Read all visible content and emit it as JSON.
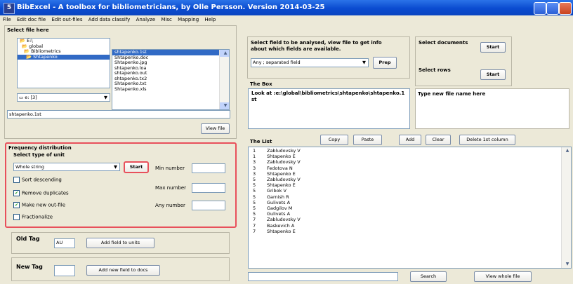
{
  "window": {
    "title": "BibExcel - A toolbox for bibliometricians, by Olle Persson. Version 2014-03-25",
    "icon": "5"
  },
  "menu": [
    "File",
    "Edit doc file",
    "Edit out-files",
    "Add data classify",
    "Analyze",
    "Misc",
    "Mapping",
    "Help"
  ],
  "select_file": {
    "heading": "Select file here",
    "folders": [
      "E:\\",
      "global",
      "Bibliometrics",
      "Shtapenko"
    ],
    "files": [
      "shtapenko.1st",
      "Shtapenko.doc",
      "Shtapenko.jpg",
      "shtapenko.loa",
      "shtapenko.out",
      "shtapenko.tx2",
      "Shtapenko.txt",
      "Shtapenko.xls"
    ],
    "drive": "e: [3]",
    "current_file": "shtapenko.1st",
    "view_file": "View file"
  },
  "frequency": {
    "heading": "Frequency distribution",
    "unit_label": "Select type of unit",
    "unit_value": "Whole string",
    "start": "Start",
    "sort_descending": "Sort descending",
    "remove_duplicates": "Remove duplicates",
    "make_new_outfile": "Make new out-file",
    "fractionalize": "Fractionalize",
    "min_number": "Min number",
    "max_number": "Max number",
    "any_number": "Any number",
    "checks": {
      "sort_descending": false,
      "remove_duplicates": true,
      "make_new_outfile": true,
      "fractionalize": false
    }
  },
  "old_tag": {
    "label": "Old Tag",
    "value": "AU",
    "button": "Add field to units"
  },
  "new_tag": {
    "label": "New Tag",
    "value": "",
    "button": "Add new field to docs"
  },
  "field": {
    "heading": "Select field to be analysed, view file to get info about which fields are available.",
    "dropdown": "Any ; separated field",
    "prep": "Prep"
  },
  "select_documents": {
    "label": "Select documents",
    "start": "Start"
  },
  "select_rows": {
    "label": "Select rows",
    "start": "Start"
  },
  "the_box": {
    "label": "The Box",
    "text": "Look at :e:\\global\\bibliometrics\\shtapenko\\shtapenko.1st"
  },
  "new_file_name": {
    "label": "Type new file name here"
  },
  "the_list": {
    "label": "The List",
    "buttons": [
      "Copy",
      "Paste",
      "Add",
      "Clear",
      "Delete 1st column"
    ],
    "rows": [
      [
        "1",
        "Zabludovsky V"
      ],
      [
        "1",
        "Shtapenko E"
      ],
      [
        "3",
        "Zabludovsky V"
      ],
      [
        "3",
        "Fedotova N"
      ],
      [
        "3",
        "Shtapenko E"
      ],
      [
        "5",
        "Zabludovsky V"
      ],
      [
        "5",
        "Shtapenko E"
      ],
      [
        "5",
        "Gribok V"
      ],
      [
        "5",
        "Garnish R"
      ],
      [
        "5",
        "Gulivets A"
      ],
      [
        "5",
        "Gadgilov M"
      ],
      [
        "5",
        "Gulivets A"
      ],
      [
        "7",
        "Zabludovsky V"
      ],
      [
        "7",
        "Baskevich A"
      ],
      [
        "7",
        "Shtapenko E"
      ]
    ],
    "search": "Search",
    "view_whole_file": "View whole file"
  },
  "colors": {
    "highlight": "#e8505b",
    "selection": "#316ac5",
    "titlebar": "#0a4bd0"
  }
}
